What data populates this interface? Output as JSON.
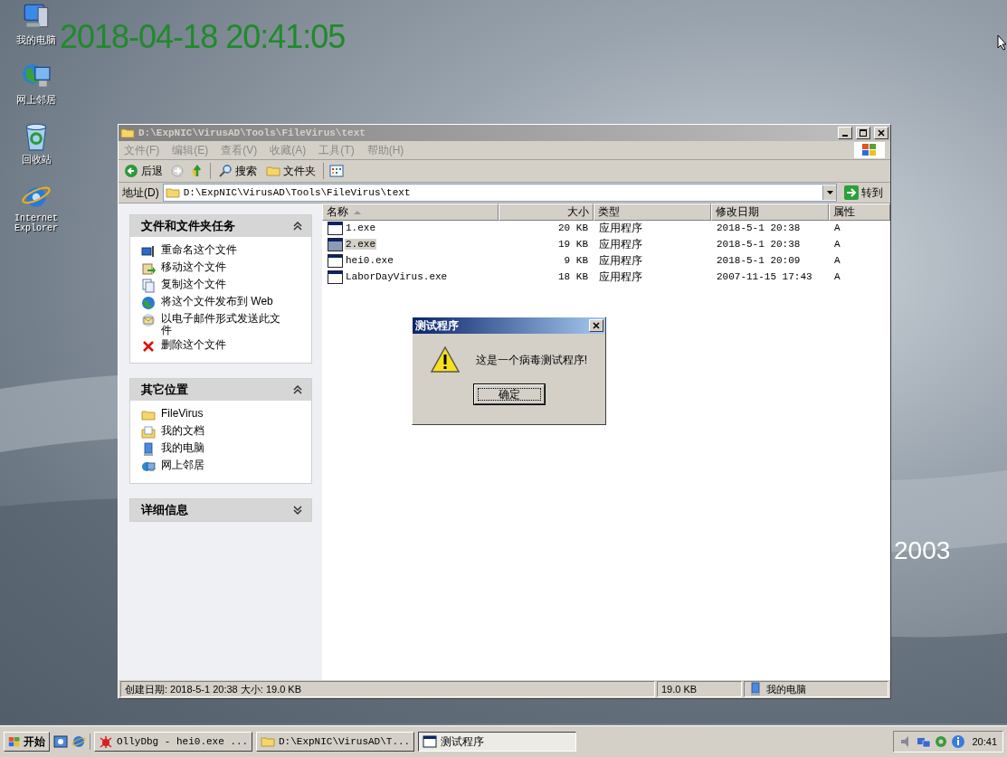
{
  "desktop": {
    "icons": [
      {
        "label": "我的电脑",
        "kind": "computer"
      },
      {
        "label": "网上邻居",
        "kind": "network"
      },
      {
        "label": "回收站",
        "kind": "recycle"
      },
      {
        "label": "Internet Explorer",
        "kind": "browser"
      }
    ],
    "timestamp": "2018-04-18 20:41:05",
    "wallpaper_text": "2003"
  },
  "explorer": {
    "title": "D:\\ExpNIC\\VirusAD\\Tools\\FileVirus\\text",
    "menu": [
      "文件(F)",
      "编辑(E)",
      "查看(V)",
      "收藏(A)",
      "工具(T)",
      "帮助(H)"
    ],
    "toolbar": {
      "back": "后退",
      "search": "搜索",
      "folders": "文件夹"
    },
    "address": {
      "label": "地址(D)",
      "value": "D:\\ExpNIC\\VirusAD\\Tools\\FileVirus\\text",
      "go": "转到"
    },
    "task_panels": [
      {
        "title": "文件和文件夹任务",
        "expanded": true,
        "items": [
          {
            "label": "重命名这个文件",
            "kind": "rename"
          },
          {
            "label": "移动这个文件",
            "kind": "move"
          },
          {
            "label": "复制这个文件",
            "kind": "copy"
          },
          {
            "label": "将这个文件发布到 Web",
            "kind": "web"
          },
          {
            "label": "以电子邮件形式发送此文件",
            "kind": "email"
          },
          {
            "label": "删除这个文件",
            "kind": "delete"
          }
        ]
      },
      {
        "title": "其它位置",
        "expanded": true,
        "items": [
          {
            "label": "FileVirus",
            "kind": "folder"
          },
          {
            "label": "我的文档",
            "kind": "documents"
          },
          {
            "label": "我的电脑",
            "kind": "computer"
          },
          {
            "label": "网上邻居",
            "kind": "network"
          }
        ]
      },
      {
        "title": "详细信息",
        "expanded": false
      }
    ],
    "columns": [
      "名称",
      "大小",
      "类型",
      "修改日期",
      "属性"
    ],
    "rows": [
      {
        "name": "1.exe",
        "size": "20 KB",
        "type": "应用程序",
        "modified": "2018-5-1 20:38",
        "attributes": "A",
        "selected": false
      },
      {
        "name": "2.exe",
        "size": "19 KB",
        "type": "应用程序",
        "modified": "2018-5-1 20:38",
        "attributes": "A",
        "selected": true
      },
      {
        "name": "hei0.exe",
        "size": "9 KB",
        "type": "应用程序",
        "modified": "2018-5-1 20:09",
        "attributes": "A",
        "selected": false
      },
      {
        "name": "LaborDayVirus.exe",
        "size": "18 KB",
        "type": "应用程序",
        "modified": "2007-11-15 17:43",
        "attributes": "A",
        "selected": false
      }
    ],
    "status": {
      "details": "创建日期: 2018-5-1 20:38 大小: 19.0 KB",
      "size": "19.0 KB",
      "zone": "我的电脑"
    }
  },
  "dialog": {
    "title": "测试程序",
    "message": "这是一个病毒测试程序!",
    "button": "确定"
  },
  "taskbar": {
    "start": "开始",
    "tasks": [
      {
        "label": "OllyDbg - hei0.exe ...",
        "kind": "debugger",
        "selected": false
      },
      {
        "label": "D:\\ExpNIC\\VirusAD\\T...",
        "kind": "folder",
        "selected": false
      },
      {
        "label": "测试程序",
        "kind": "window",
        "selected": true
      }
    ],
    "clock": "20:41"
  }
}
